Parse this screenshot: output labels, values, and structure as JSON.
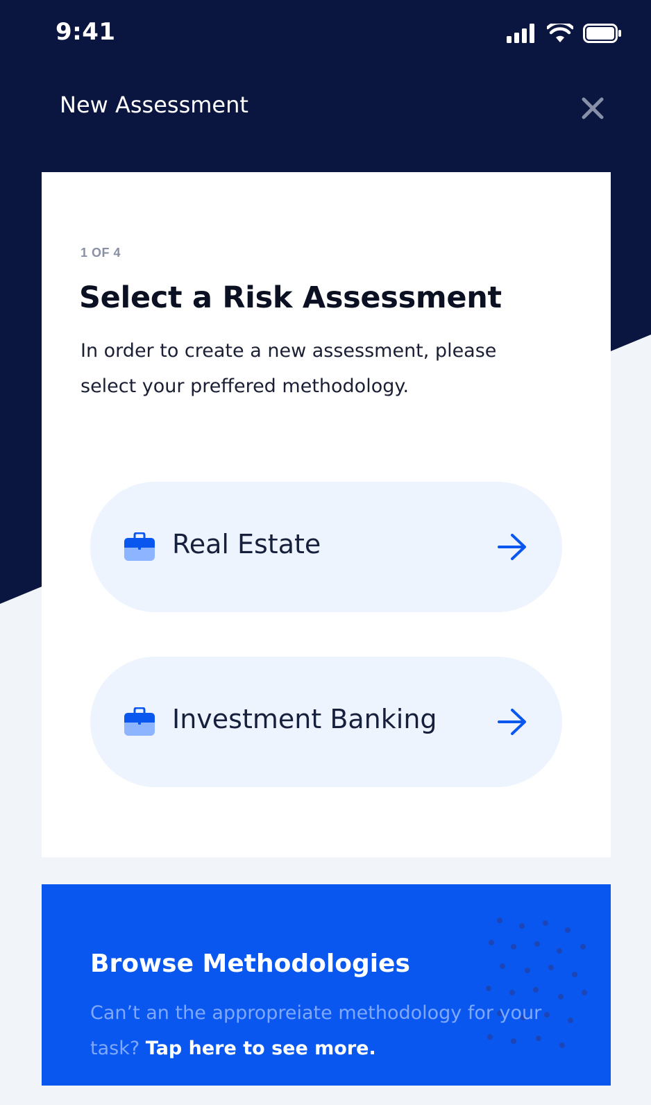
{
  "status_bar": {
    "time": "9:41",
    "signal_icon": "cellular-signal-icon",
    "wifi_icon": "wifi-icon",
    "battery_icon": "battery-icon"
  },
  "header": {
    "title": "New Assessment",
    "close_icon": "close-icon"
  },
  "card": {
    "step": "1 OF 4",
    "title": "Select a Risk Assessment",
    "description": "In order to create a new assessment, please select your preffered methodology.",
    "options": [
      {
        "label": "Real Estate",
        "icon": "briefcase-icon",
        "arrow_icon": "arrow-right-icon"
      },
      {
        "label": "Investment Banking",
        "icon": "briefcase-icon",
        "arrow_icon": "arrow-right-icon"
      }
    ]
  },
  "banner": {
    "title": "Browse Methodologies",
    "text": "Can’t an the appropreiate methodology for your task?",
    "link": "Tap here to see more."
  },
  "colors": {
    "navy": "#0b1640",
    "background": "#f1f4f9",
    "accent_blue": "#0a57f0",
    "option_bg": "#eef4fd"
  }
}
